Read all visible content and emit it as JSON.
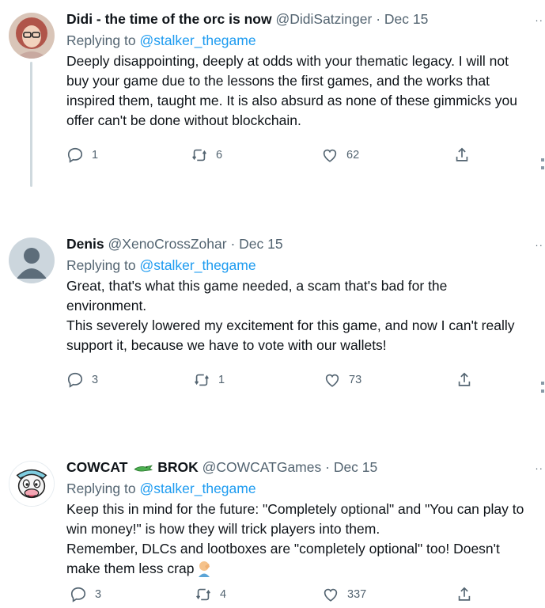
{
  "tweets": [
    {
      "display_name": "Didi - the time of the orc is now",
      "handle": "@DidiSatzinger",
      "separator": "·",
      "date": "Dec 15",
      "replying_prefix": "Replying to",
      "replying_handle": "@stalker_thegame",
      "body": "Deeply disappointing, deeply at odds with your thematic legacy. I will not\nbuy your game due to the lessons the first games, and the works that\ninspired them, taught me. It is also absurd as none of these gimmicks you\noffer can't be done without blockchain.",
      "replies": "1",
      "retweets": "6",
      "likes": "62"
    },
    {
      "display_name": "Denis",
      "handle": "@XenoCrossZohar",
      "separator": "·",
      "date": "Dec 15",
      "replying_prefix": "Replying to",
      "replying_handle": "@stalker_thegame",
      "body": "Great, that's what this game needed, a scam that's bad for the\nenvironment.\nThis severely lowered my excitement for this game, and now I can't really\nsupport it, because we have to vote with our wallets!",
      "replies": "3",
      "retweets": "1",
      "likes": "73"
    },
    {
      "display_name_part1": "COWCAT",
      "display_name_part2": "BROK",
      "handle": "@COWCATGames",
      "separator": "·",
      "date": "Dec 15",
      "replying_prefix": "Replying to",
      "replying_handle": "@stalker_thegame",
      "body": "Keep this in mind for the future: \"Completely optional\" and \"You can play to\nwin money!\" is how they will trick players into them.\nRemember, DLCs and lootboxes are \"completely optional\" too! Doesn't\nmake them less crap",
      "replies": "3",
      "retweets": "4",
      "likes": "337"
    }
  ],
  "icons": {
    "reply": "reply-icon",
    "retweet": "retweet-icon",
    "like": "heart-icon",
    "share": "share-icon",
    "crocodile": "crocodile-emoji",
    "facepalm": "facepalm-emoji"
  },
  "colors": {
    "link": "#1d9bf0",
    "secondary": "#536471",
    "text": "#0f1419",
    "thread_line": "#cfd9de"
  }
}
